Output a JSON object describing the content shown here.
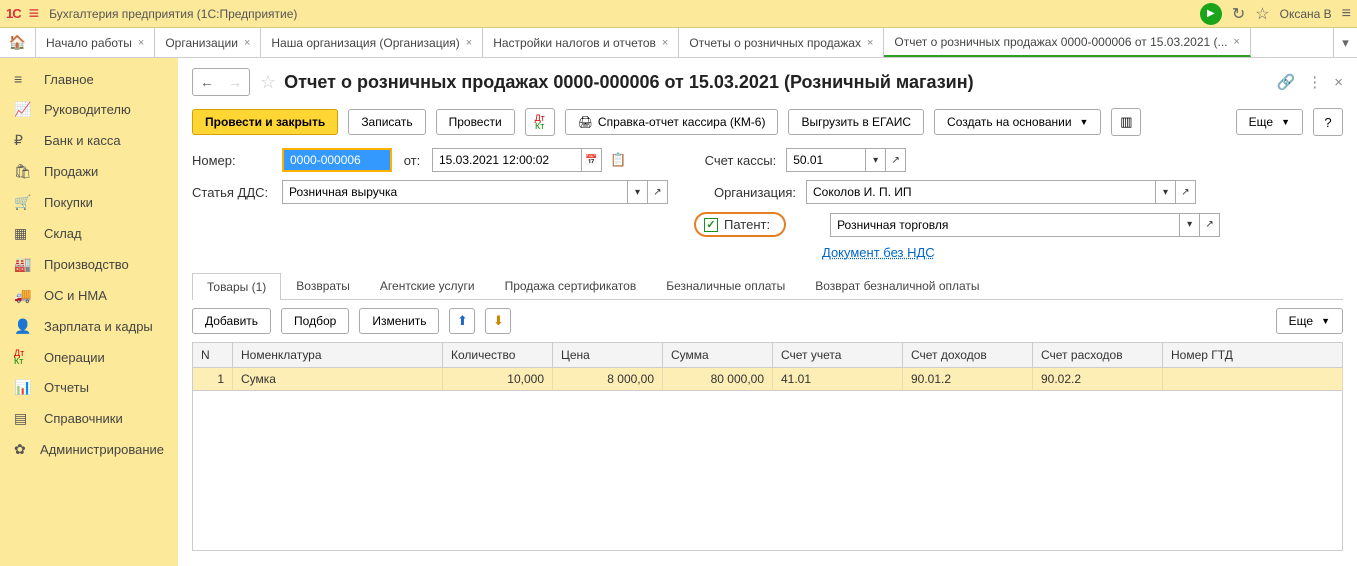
{
  "titlebar": {
    "logo": "1C",
    "title": "Бухгалтерия предприятия (1С:Предприятие)",
    "user": "Оксана В"
  },
  "tabs": [
    {
      "label": "Начало работы"
    },
    {
      "label": "Организации"
    },
    {
      "label": "Наша организация (Организация)"
    },
    {
      "label": "Настройки налогов и отчетов"
    },
    {
      "label": "Отчеты о розничных продажах"
    },
    {
      "label": "Отчет о розничных продажах 0000-000006 от 15.03.2021 (...",
      "active": true
    }
  ],
  "sidebar": [
    {
      "icon": "menu",
      "label": "Главное"
    },
    {
      "icon": "chart",
      "label": "Руководителю"
    },
    {
      "icon": "ruble",
      "label": "Банк и касса"
    },
    {
      "icon": "bag",
      "label": "Продажи"
    },
    {
      "icon": "cart",
      "label": "Покупки"
    },
    {
      "icon": "boxes",
      "label": "Склад"
    },
    {
      "icon": "factory",
      "label": "Производство"
    },
    {
      "icon": "truck",
      "label": "ОС и НМА"
    },
    {
      "icon": "person",
      "label": "Зарплата и кадры"
    },
    {
      "icon": "dtkt",
      "label": "Операции"
    },
    {
      "icon": "bars",
      "label": "Отчеты"
    },
    {
      "icon": "book",
      "label": "Справочники"
    },
    {
      "icon": "gear",
      "label": "Администрирование"
    }
  ],
  "document": {
    "title": "Отчет о розничных продажах 0000-000006 от 15.03.2021 (Розничный магазин)"
  },
  "toolbar": {
    "post_close": "Провести и закрыть",
    "record": "Записать",
    "post": "Провести",
    "km6": "Справка-отчет кассира (КМ-6)",
    "egais": "Выгрузить в ЕГАИС",
    "create_basis": "Создать на основании",
    "more": "Еще",
    "help": "?"
  },
  "form": {
    "number_label": "Номер:",
    "number": "0000-000006",
    "ot_label": "от:",
    "date": "15.03.2021 12:00:02",
    "schet_kassy_label": "Счет кассы:",
    "schet_kassy": "50.01",
    "statya_dds_label": "Статья ДДС:",
    "statya_dds": "Розничная выручка",
    "org_label": "Организация:",
    "org": "Соколов И. П. ИП",
    "patent_label": "Патент:",
    "patent_value": "Розничная торговля",
    "nds_link": "Документ без НДС"
  },
  "doc_tabs": [
    {
      "label": "Товары (1)",
      "active": true
    },
    {
      "label": "Возвраты"
    },
    {
      "label": "Агентские услуги"
    },
    {
      "label": "Продажа сертификатов"
    },
    {
      "label": "Безналичные оплаты"
    },
    {
      "label": "Возврат безналичной оплаты"
    }
  ],
  "tbl_toolbar": {
    "add": "Добавить",
    "select": "Подбор",
    "change": "Изменить",
    "more": "Еще"
  },
  "table": {
    "headers": [
      "N",
      "Номенклатура",
      "Количество",
      "Цена",
      "Сумма",
      "Счет учета",
      "Счет доходов",
      "Счет расходов",
      "Номер ГТД"
    ],
    "rows": [
      {
        "n": "1",
        "nom": "Сумка",
        "qty": "10,000",
        "price": "8 000,00",
        "sum": "80 000,00",
        "acc": "41.01",
        "inc": "90.01.2",
        "exp": "90.02.2",
        "gtd": ""
      }
    ]
  }
}
